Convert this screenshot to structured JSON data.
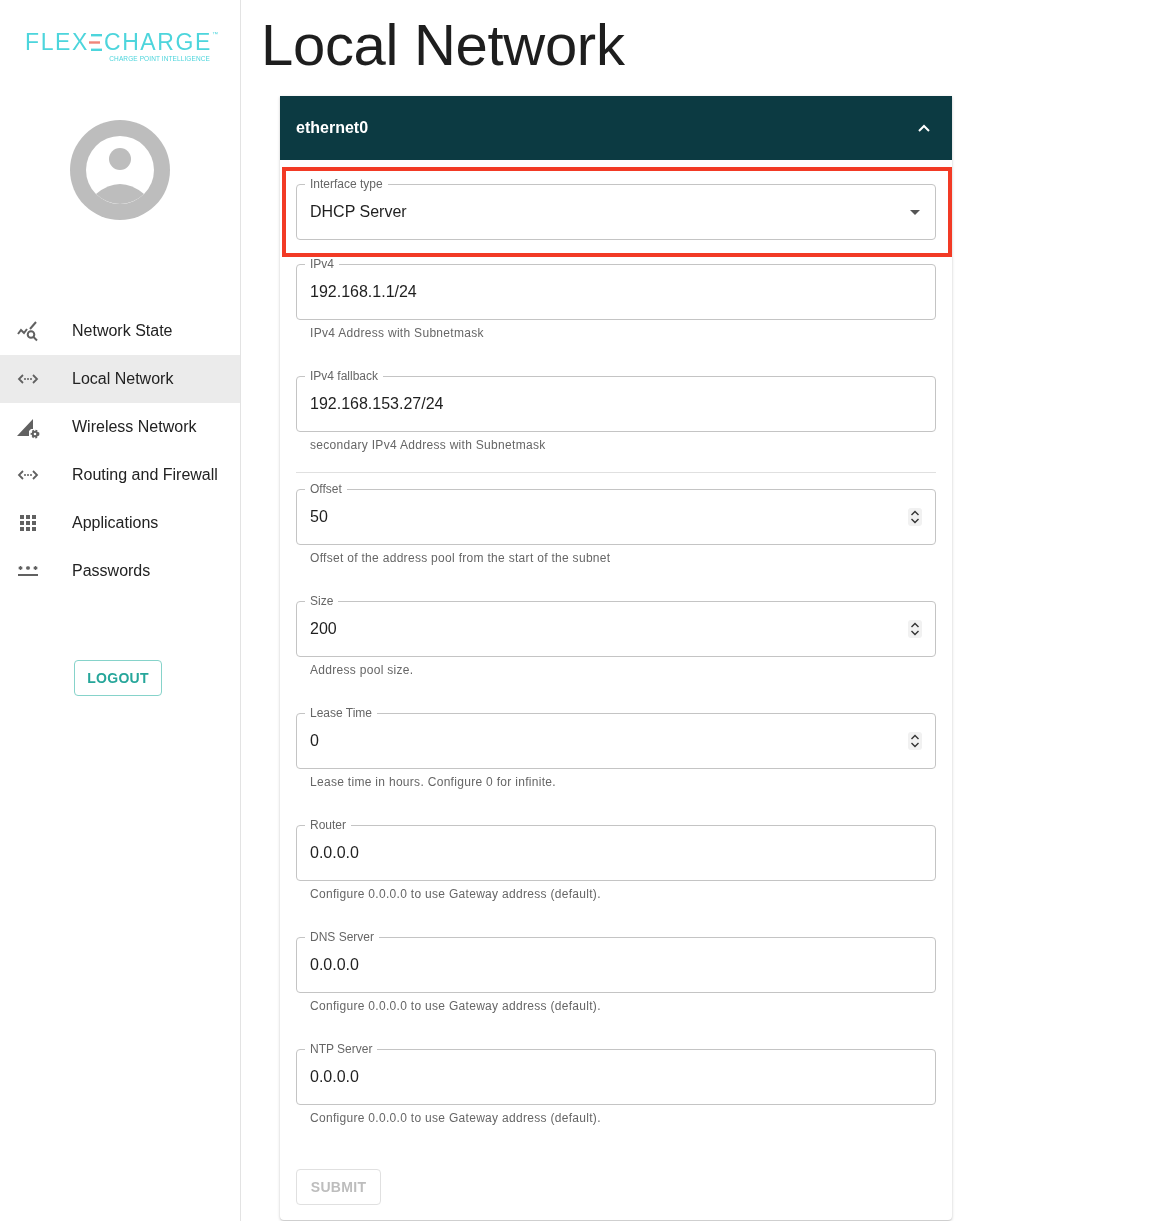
{
  "sidebar": {
    "logo": {
      "text_left": "FLEX",
      "text_right": "CHARGE",
      "trademark": "™",
      "tagline": "CHARGE POINT INTELLIGENCE"
    },
    "nav_items": [
      {
        "label": "Network State",
        "selected": false
      },
      {
        "label": "Local Network",
        "selected": true
      },
      {
        "label": "Wireless Network",
        "selected": false
      },
      {
        "label": "Routing and Firewall",
        "selected": false
      },
      {
        "label": "Applications",
        "selected": false
      },
      {
        "label": "Passwords",
        "selected": false
      }
    ],
    "logout_button": "LOGOUT"
  },
  "page_title": "Local Network",
  "panel": {
    "title": "ethernet0",
    "expanded": true,
    "sections": [
      {
        "fields": [
          {
            "kind": "select",
            "label": "Interface type",
            "value": "DHCP Server",
            "highlighted": true
          },
          {
            "kind": "text",
            "label": "IPv4",
            "value": "192.168.1.1/24",
            "helper": "IPv4 Address with Subnetmask",
            "highlighted": false
          },
          {
            "kind": "text",
            "label": "IPv4 fallback",
            "value": "192.168.153.27/24",
            "helper": "secondary IPv4 Address with Subnetmask",
            "highlighted": false
          }
        ]
      },
      {
        "fields": [
          {
            "kind": "number",
            "label": "Offset",
            "value": "50",
            "helper": "Offset of the address pool from the start of the subnet",
            "highlighted": false
          },
          {
            "kind": "number",
            "label": "Size",
            "value": "200",
            "helper": "Address pool size.",
            "highlighted": false
          },
          {
            "kind": "number",
            "label": "Lease Time",
            "value": "0",
            "helper": "Lease time in hours. Configure 0 for infinite.",
            "highlighted": false
          },
          {
            "kind": "text",
            "label": "Router",
            "value": "0.0.0.0",
            "helper": "Configure 0.0.0.0 to use Gateway address (default).",
            "highlighted": false
          },
          {
            "kind": "text",
            "label": "DNS Server",
            "value": "0.0.0.0",
            "helper": "Configure 0.0.0.0 to use Gateway address (default).",
            "highlighted": false
          },
          {
            "kind": "text",
            "label": "NTP Server",
            "value": "0.0.0.0",
            "helper": "Configure 0.0.0.0 to use Gateway address (default).",
            "highlighted": false
          }
        ]
      }
    ],
    "submit_button": {
      "label": "SUBMIT",
      "disabled": true
    }
  }
}
